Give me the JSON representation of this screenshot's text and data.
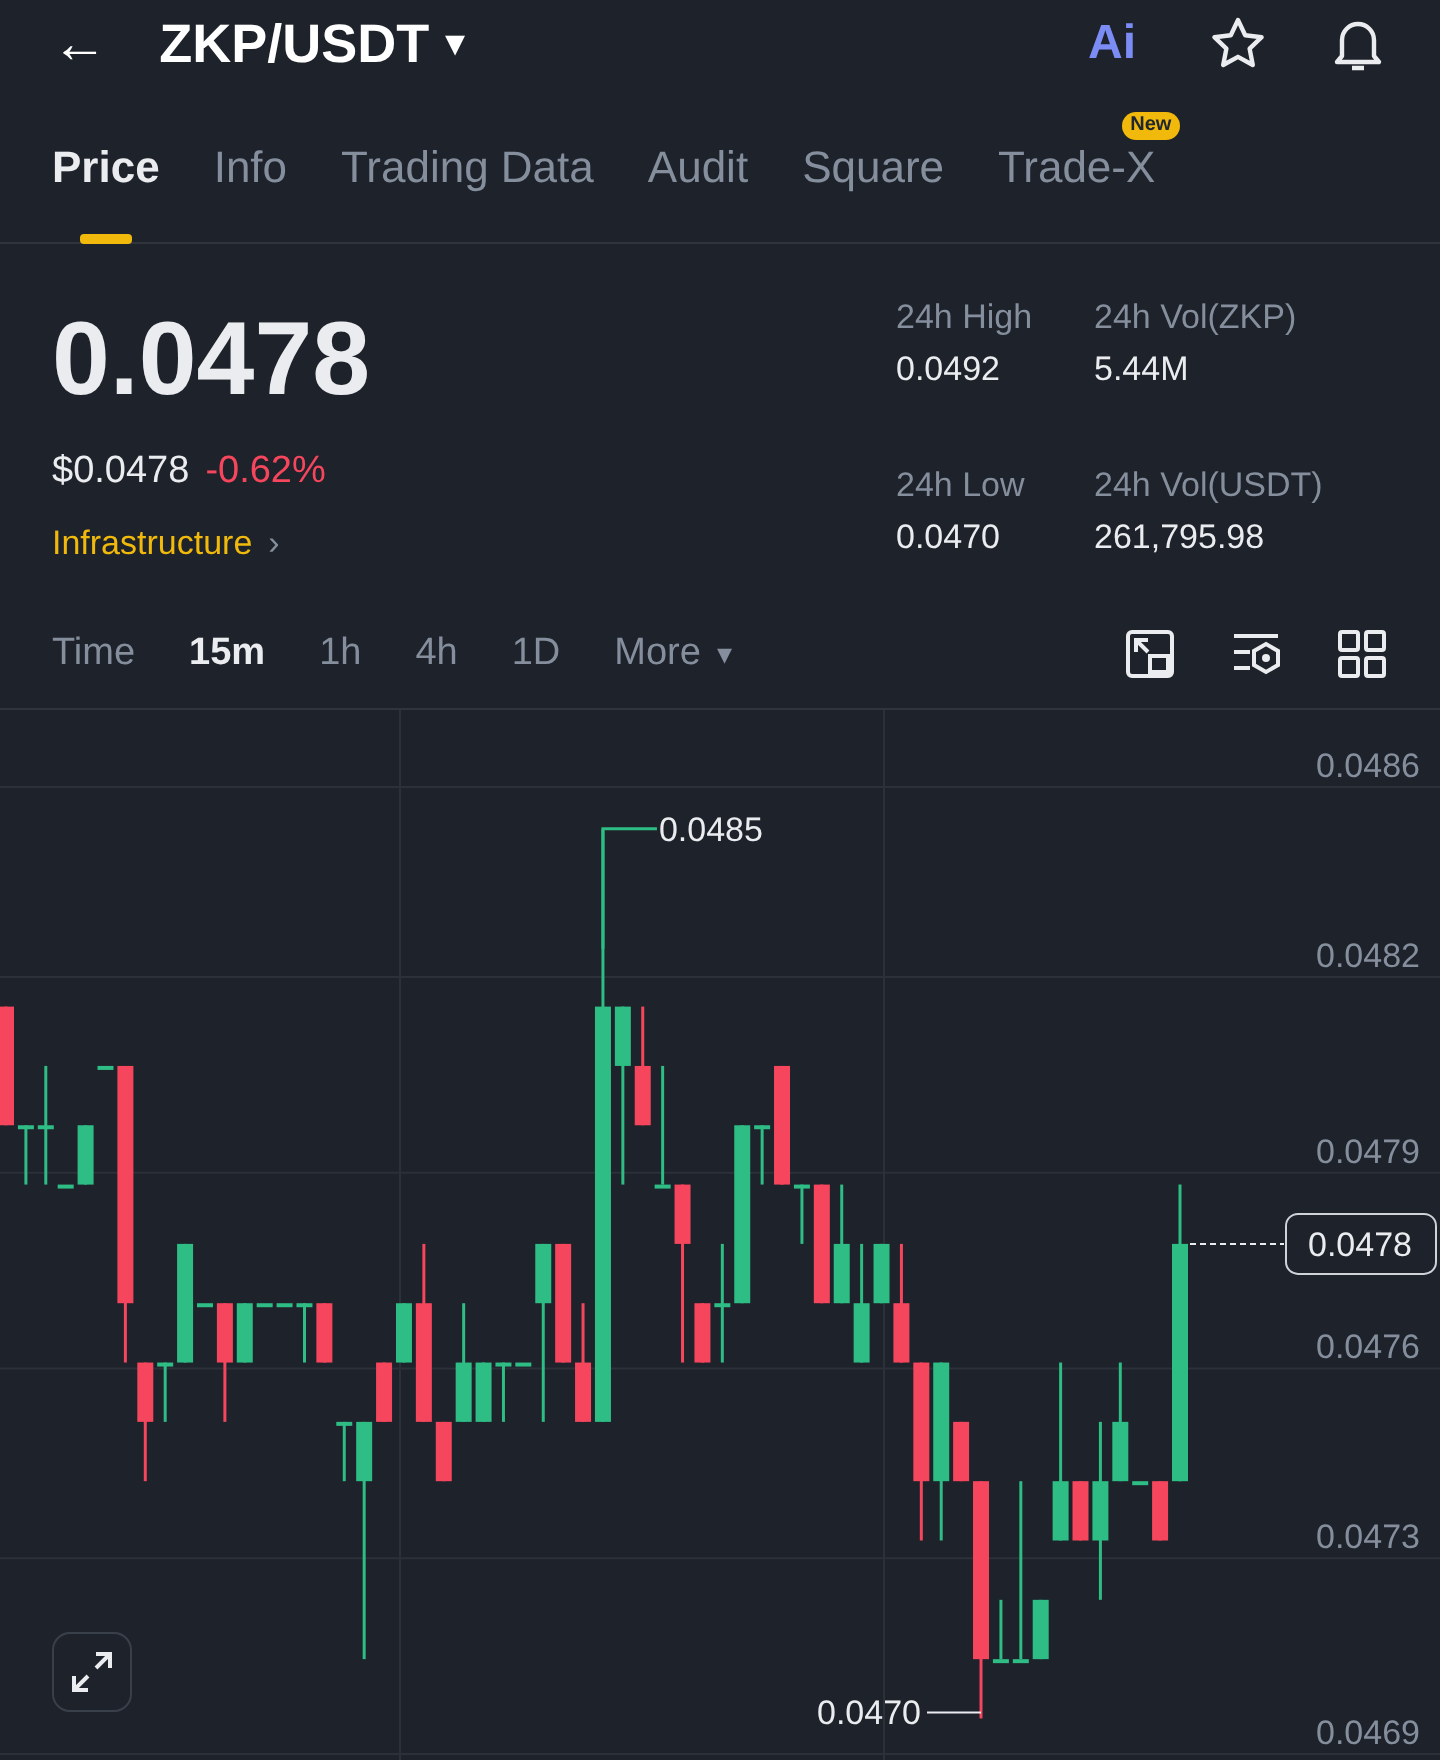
{
  "header": {
    "back": "←",
    "pair": "ZKP/USDT",
    "caret": "▾",
    "ai_button": "Ai"
  },
  "tabs": [
    {
      "label": "Price",
      "selected": true
    },
    {
      "label": "Info",
      "selected": false
    },
    {
      "label": "Trading Data",
      "selected": false
    },
    {
      "label": "Audit",
      "selected": false
    },
    {
      "label": "Square",
      "selected": false
    },
    {
      "label": "Trade-X",
      "selected": false,
      "badge": "New"
    }
  ],
  "price": {
    "last": "0.0478",
    "usd": "$0.0478",
    "change": "-0.62%",
    "category": "Infrastructure",
    "category_arrow": "›"
  },
  "stats": [
    {
      "label": "24h High",
      "value": "0.0492"
    },
    {
      "label": "24h Vol(ZKP)",
      "value": "5.44M"
    },
    {
      "label": "24h Low",
      "value": "0.0470"
    },
    {
      "label": "24h Vol(USDT)",
      "value": "261,795.98"
    }
  ],
  "intervals": [
    {
      "label": "Time",
      "selected": false,
      "kind": "plain"
    },
    {
      "label": "15m",
      "selected": true,
      "kind": "plain"
    },
    {
      "label": "1h",
      "selected": false,
      "kind": "plain"
    },
    {
      "label": "4h",
      "selected": false,
      "kind": "plain"
    },
    {
      "label": "1D",
      "selected": false,
      "kind": "plain"
    },
    {
      "label": "More",
      "selected": false,
      "kind": "dropdown",
      "caret": "▾"
    }
  ],
  "chart": {
    "high_label": "0.0485",
    "low_label": "0.0470",
    "last_price_tag": "0.0478",
    "chart_data": {
      "type": "candlestick",
      "grid": true,
      "ylim": [
        0.04693,
        0.0487
      ],
      "yticks": [
        {
          "value": 0.04857,
          "label": "0.0486"
        },
        {
          "value": 0.04825,
          "label": "0.0482"
        },
        {
          "value": 0.04792,
          "label": "0.0479"
        },
        {
          "value": 0.04759,
          "label": "0.0476"
        },
        {
          "value": 0.04727,
          "label": "0.0473"
        },
        {
          "value": 0.04694,
          "label": "0.0469"
        }
      ],
      "ohlc": [
        [
          0.0482,
          0.0482,
          0.048,
          0.048
        ],
        [
          0.048,
          0.048,
          0.0479,
          0.048
        ],
        [
          0.048,
          0.0481,
          0.0479,
          0.048
        ],
        [
          0.0479,
          0.0479,
          0.0479,
          0.0479
        ],
        [
          0.0479,
          0.048,
          0.0479,
          0.048
        ],
        [
          0.0481,
          0.0481,
          0.0481,
          0.0481
        ],
        [
          0.0481,
          0.0481,
          0.0476,
          0.0477
        ],
        [
          0.0476,
          0.0476,
          0.0474,
          0.0475
        ],
        [
          0.0476,
          0.0476,
          0.0475,
          0.0476
        ],
        [
          0.0476,
          0.0478,
          0.0476,
          0.0478
        ],
        [
          0.0477,
          0.0477,
          0.0477,
          0.0477
        ],
        [
          0.0477,
          0.0477,
          0.0475,
          0.0476
        ],
        [
          0.0476,
          0.0477,
          0.0476,
          0.0477
        ],
        [
          0.0477,
          0.0477,
          0.0477,
          0.0477
        ],
        [
          0.0477,
          0.0477,
          0.0477,
          0.0477
        ],
        [
          0.0477,
          0.0477,
          0.0476,
          0.0477
        ],
        [
          0.0477,
          0.0477,
          0.0476,
          0.0476
        ],
        [
          0.0475,
          0.0475,
          0.0474,
          0.0475
        ],
        [
          0.0474,
          0.0475,
          0.0471,
          0.0475
        ],
        [
          0.0476,
          0.0476,
          0.0475,
          0.0475
        ],
        [
          0.0476,
          0.0477,
          0.0476,
          0.0477
        ],
        [
          0.0477,
          0.0478,
          0.0475,
          0.0475
        ],
        [
          0.0475,
          0.0475,
          0.0474,
          0.0474
        ],
        [
          0.0475,
          0.0477,
          0.0475,
          0.0476
        ],
        [
          0.0475,
          0.0476,
          0.0475,
          0.0476
        ],
        [
          0.0476,
          0.0476,
          0.0475,
          0.0476
        ],
        [
          0.0476,
          0.0476,
          0.0476,
          0.0476
        ],
        [
          0.0477,
          0.0478,
          0.0475,
          0.0478
        ],
        [
          0.0478,
          0.0478,
          0.0476,
          0.0476
        ],
        [
          0.0476,
          0.0477,
          0.0475,
          0.0475
        ],
        [
          0.0475,
          0.0485,
          0.0475,
          0.0482
        ],
        [
          0.0481,
          0.0482,
          0.0479,
          0.0482
        ],
        [
          0.0481,
          0.0482,
          0.048,
          0.048
        ],
        [
          0.0479,
          0.0481,
          0.0479,
          0.0479
        ],
        [
          0.0479,
          0.0479,
          0.0476,
          0.0478
        ],
        [
          0.0477,
          0.0477,
          0.0476,
          0.0476
        ],
        [
          0.0477,
          0.0478,
          0.0476,
          0.0477
        ],
        [
          0.0477,
          0.048,
          0.0477,
          0.048
        ],
        [
          0.048,
          0.048,
          0.0479,
          0.048
        ],
        [
          0.0481,
          0.0481,
          0.0479,
          0.0479
        ],
        [
          0.0479,
          0.0479,
          0.0478,
          0.0479
        ],
        [
          0.0479,
          0.0479,
          0.0477,
          0.0477
        ],
        [
          0.0477,
          0.0479,
          0.0477,
          0.0478
        ],
        [
          0.0476,
          0.0478,
          0.0476,
          0.0477
        ],
        [
          0.0477,
          0.0478,
          0.0477,
          0.0478
        ],
        [
          0.0477,
          0.0478,
          0.0476,
          0.0476
        ],
        [
          0.0476,
          0.0476,
          0.0473,
          0.0474
        ],
        [
          0.0474,
          0.0476,
          0.0473,
          0.0476
        ],
        [
          0.0475,
          0.0475,
          0.0474,
          0.0474
        ],
        [
          0.0474,
          0.0474,
          0.047,
          0.0471
        ],
        [
          0.0471,
          0.0472,
          0.0471,
          0.0471
        ],
        [
          0.0471,
          0.0474,
          0.0471,
          0.0471
        ],
        [
          0.0471,
          0.0472,
          0.0471,
          0.0472
        ],
        [
          0.0473,
          0.0476,
          0.0473,
          0.0474
        ],
        [
          0.0474,
          0.0474,
          0.0473,
          0.0473
        ],
        [
          0.0473,
          0.0475,
          0.0472,
          0.0474
        ],
        [
          0.0474,
          0.0476,
          0.0474,
          0.0475
        ],
        [
          0.0474,
          0.0474,
          0.0474,
          0.0474
        ],
        [
          0.0474,
          0.0474,
          0.0473,
          0.0473
        ],
        [
          0.0474,
          0.0479,
          0.0474,
          0.0478
        ]
      ]
    }
  }
}
